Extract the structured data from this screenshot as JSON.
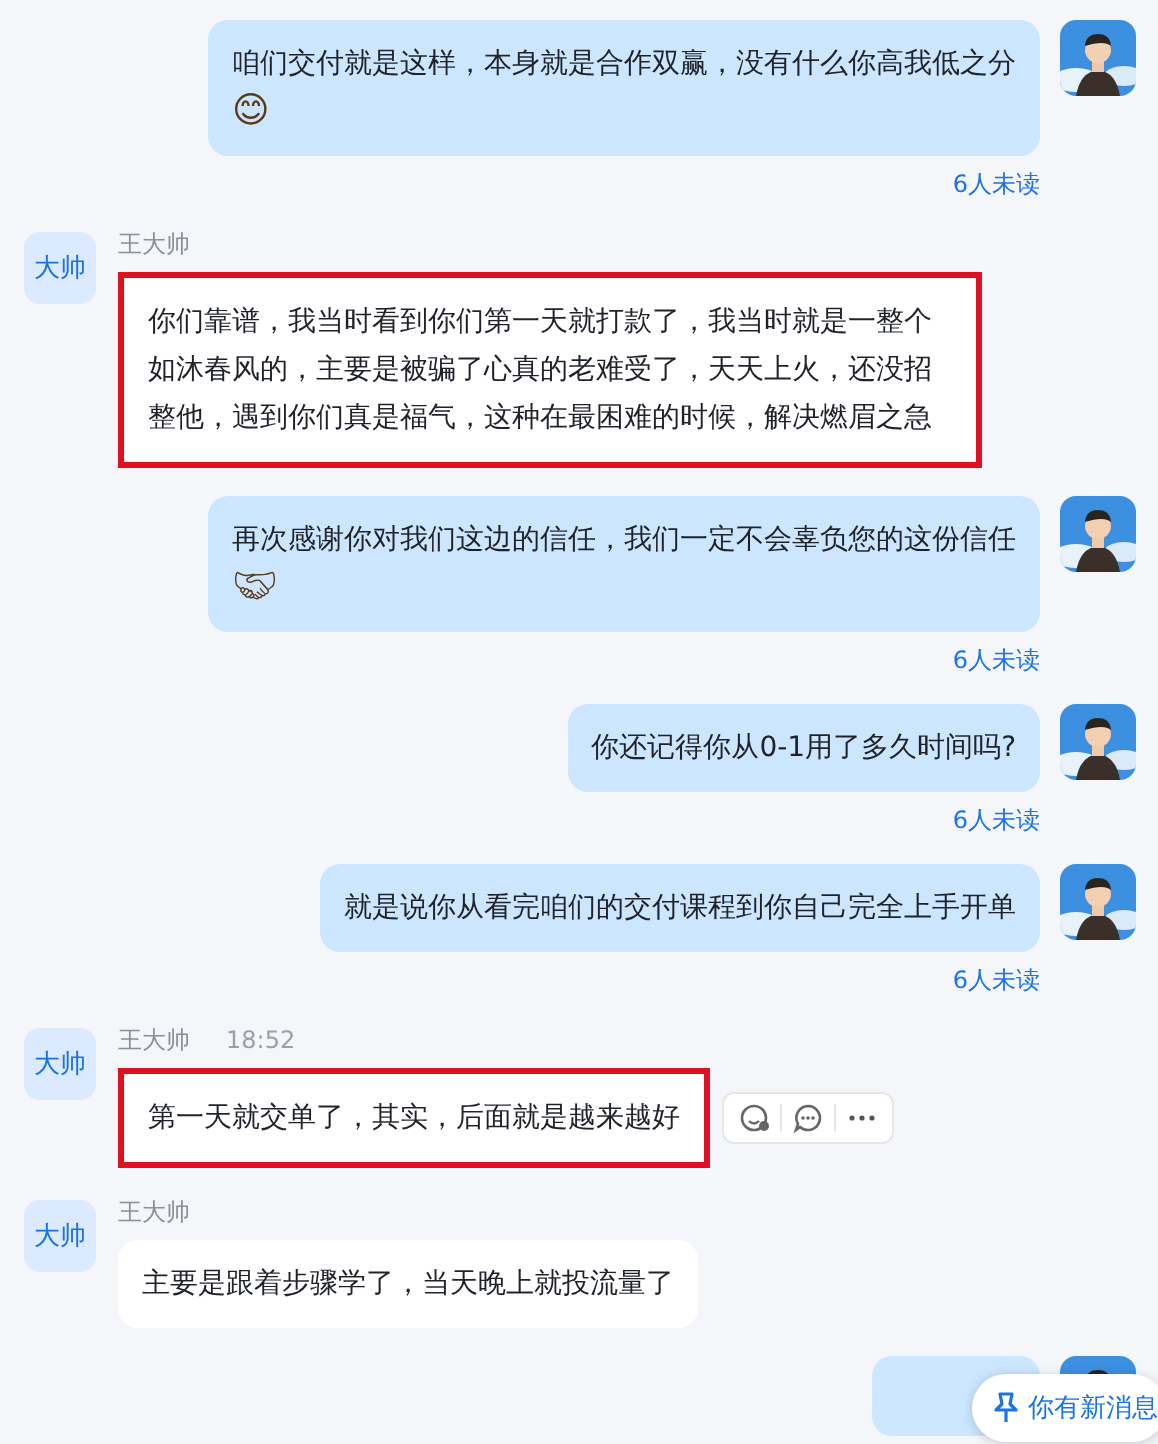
{
  "messages": [
    {
      "kind": "self",
      "text": "咱们交付就是这样，本身就是合作双赢，没有什么你高我低之分",
      "emoji": "😊",
      "status": "6人未读"
    },
    {
      "kind": "other",
      "avatar": "大帅",
      "name": "王大帅",
      "text": "你们靠谱，我当时看到你们第一天就打款了，我当时就是一整个如沐春风的，主要是被骗了心真的老难受了，天天上火，还没招整他，遇到你们真是福气，这种在最困难的时候，解决燃眉之急",
      "highlighted": true,
      "actions": false
    },
    {
      "kind": "self",
      "text": "再次感谢你对我们这边的信任，我们一定不会辜负您的这份信任",
      "emoji": "🤝",
      "status": "6人未读"
    },
    {
      "kind": "self",
      "text": "你还记得你从0-1用了多久时间吗?",
      "status": "6人未读"
    },
    {
      "kind": "self",
      "text": "就是说你从看完咱们的交付课程到你自己完全上手开单",
      "status": "6人未读"
    },
    {
      "kind": "other",
      "avatar": "大帅",
      "name": "王大帅",
      "time": "18:52",
      "text": "第一天就交单了，其实，后面就是越来越好",
      "highlighted": true,
      "actions": true
    },
    {
      "kind": "other",
      "avatar": "大帅",
      "name": "王大帅",
      "text": "主要是跟着步骤学了，当天晚上就投流量了",
      "highlighted": false,
      "actions": false
    },
    {
      "kind": "self"
    }
  ],
  "new_message_pill": {
    "label": "你有新消息"
  }
}
